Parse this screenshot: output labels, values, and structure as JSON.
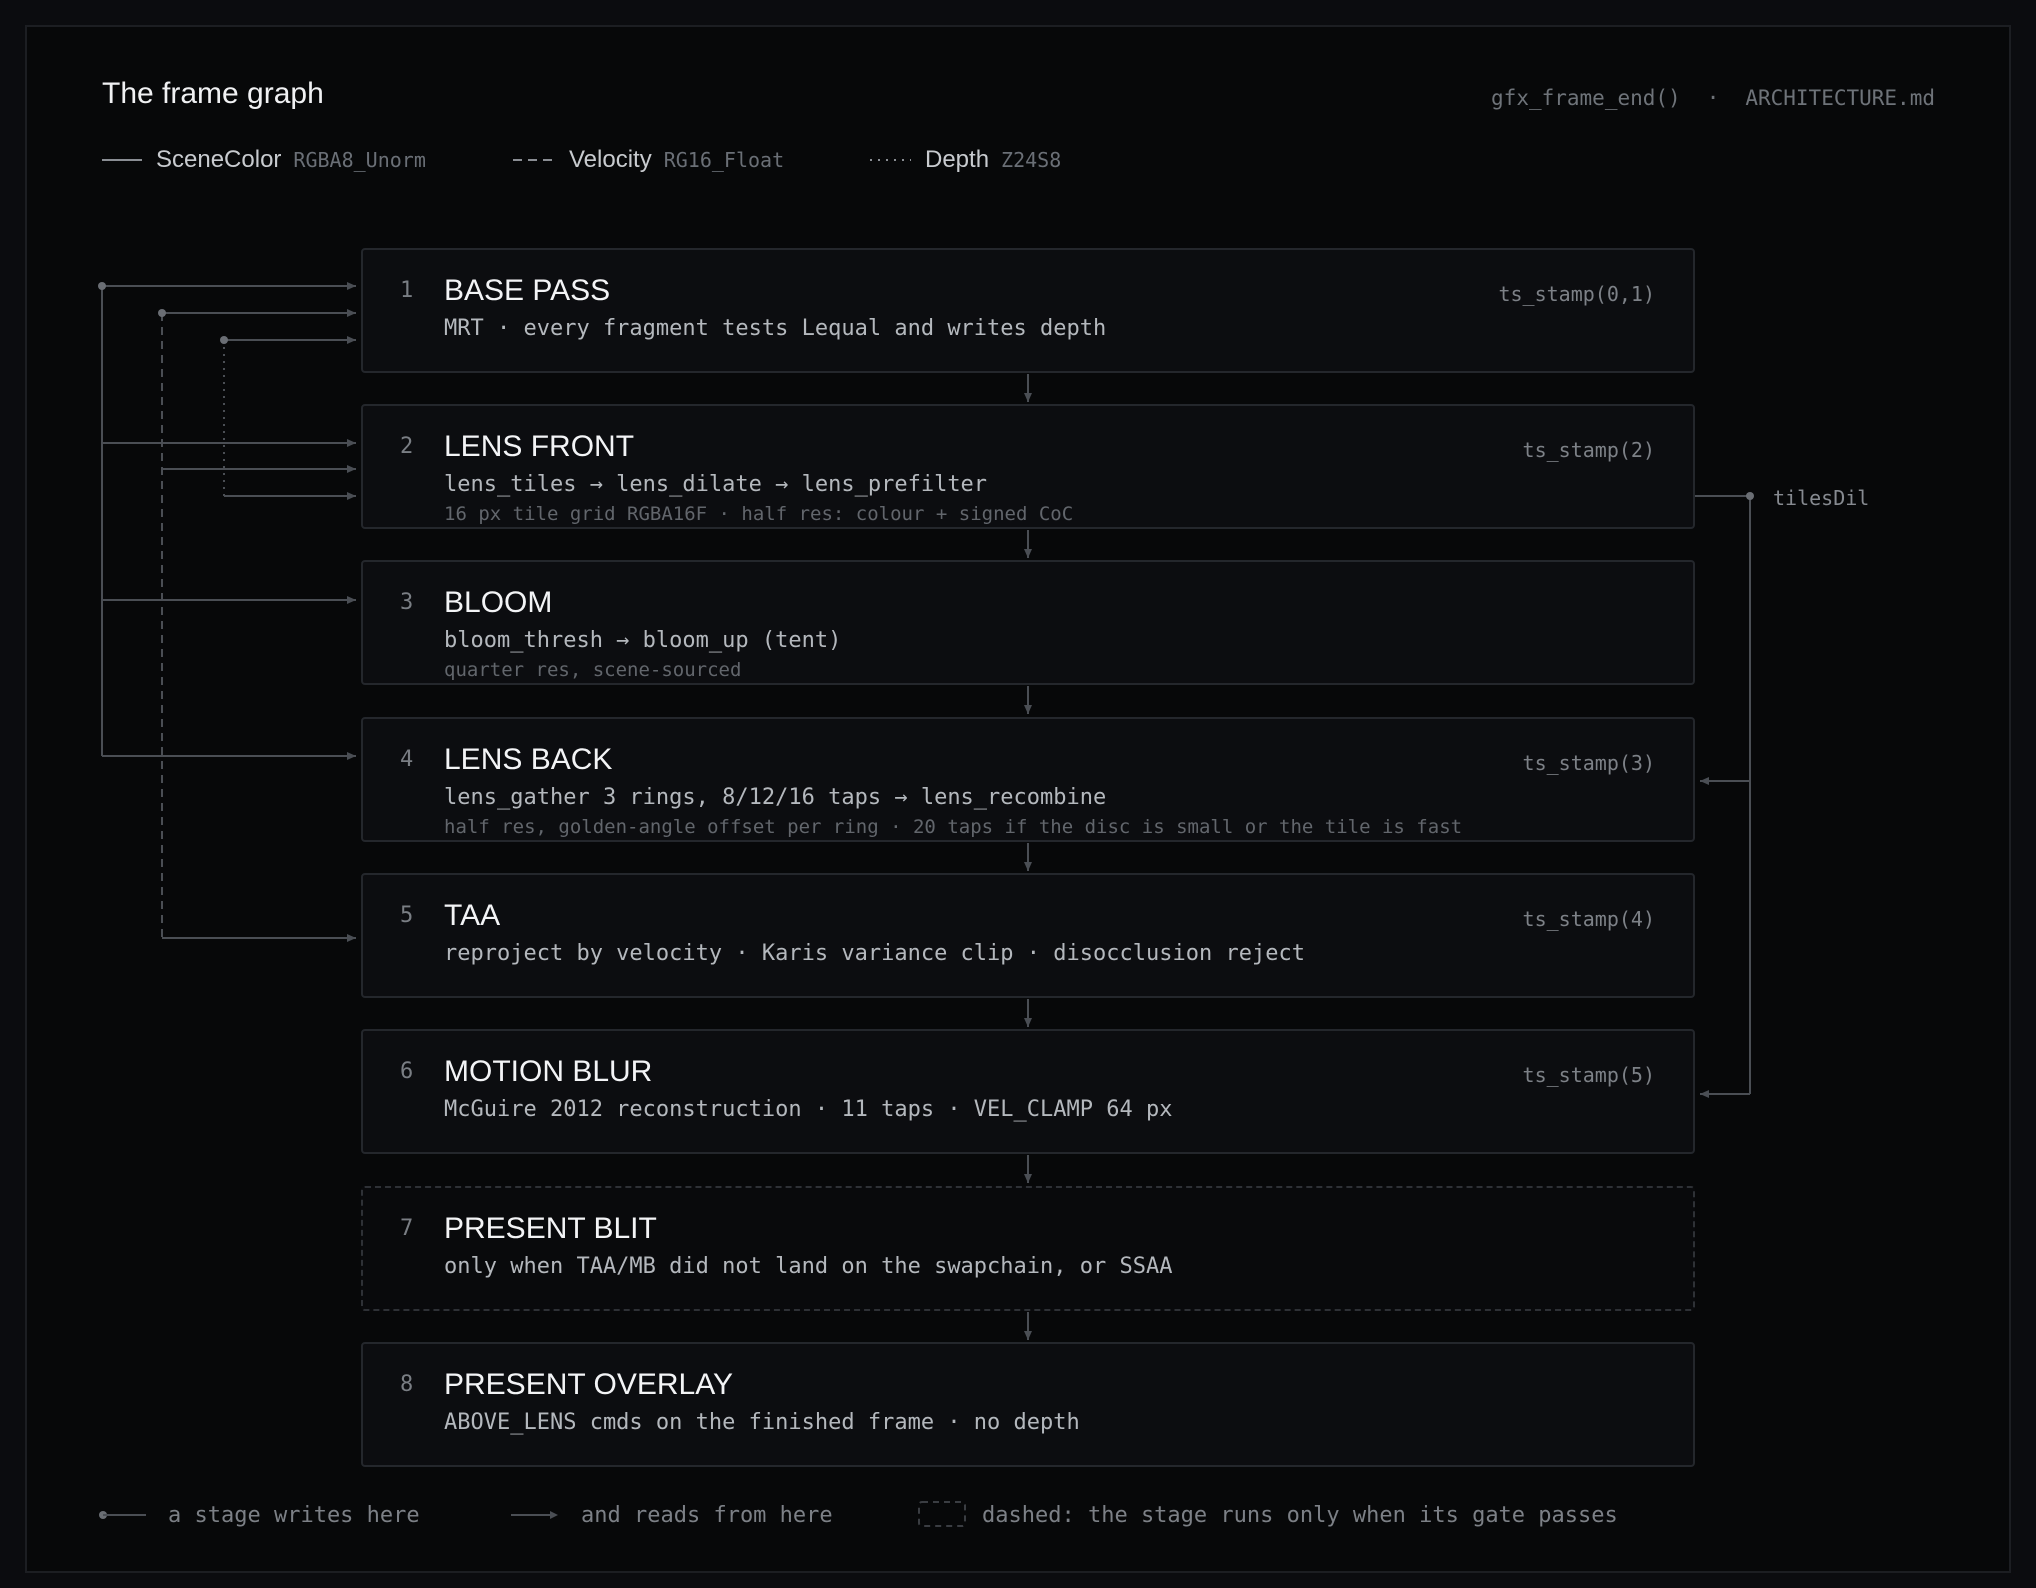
{
  "header": {
    "title": "The frame graph",
    "link_fn": "gfx_frame_end()",
    "separator": "·",
    "link_doc": "ARCHITECTURE.md"
  },
  "legend": [
    {
      "name": "SceneColor",
      "format": "RGBA8_Unorm",
      "line_style": "solid"
    },
    {
      "name": "Velocity",
      "format": "RG16_Float",
      "line_style": "dashed"
    },
    {
      "name": "Depth",
      "format": "Z24S8",
      "line_style": "dotted"
    }
  ],
  "stages": [
    {
      "num": "1",
      "name": "BASE PASS",
      "desc": "MRT · every fragment tests Lequal and writes depth",
      "sub": "",
      "ts": "ts_stamp(0,1)",
      "gated": false
    },
    {
      "num": "2",
      "name": "LENS FRONT",
      "desc": "lens_tiles → lens_dilate → lens_prefilter",
      "sub": "16 px tile grid RGBA16F  ·  half res: colour + signed CoC",
      "ts": "ts_stamp(2)",
      "gated": false
    },
    {
      "num": "3",
      "name": "BLOOM",
      "desc": "bloom_thresh → bloom_up (tent)",
      "sub": "quarter res, scene-sourced",
      "ts": "",
      "gated": false
    },
    {
      "num": "4",
      "name": "LENS BACK",
      "desc": "lens_gather 3 rings, 8/12/16 taps → lens_recombine",
      "sub": "half res, golden-angle offset per ring  ·  20 taps if the disc is small or the tile is fast",
      "ts": "ts_stamp(3)",
      "gated": false
    },
    {
      "num": "5",
      "name": "TAA",
      "desc": "reproject by velocity · Karis variance clip · disocclusion reject",
      "sub": "",
      "ts": "ts_stamp(4)",
      "gated": false
    },
    {
      "num": "6",
      "name": "MOTION BLUR",
      "desc": "McGuire 2012 reconstruction · 11 taps · VEL_CLAMP 64 px",
      "sub": "",
      "ts": "ts_stamp(5)",
      "gated": false
    },
    {
      "num": "7",
      "name": "PRESENT BLIT",
      "desc": "only when TAA/MB did not land on the swapchain, or SSAA",
      "sub": "",
      "ts": "",
      "gated": true
    },
    {
      "num": "8",
      "name": "PRESENT OVERLAY",
      "desc": "ABOVE_LENS cmds on the finished frame · no depth",
      "sub": "",
      "ts": "",
      "gated": false
    }
  ],
  "side_resource": {
    "label": "tilesDil"
  },
  "footer": {
    "writes": "a stage writes here",
    "reads": "and reads from here",
    "gated": "dashed: the stage runs only when its gate passes"
  },
  "colors": {
    "background": "#070809",
    "border": "#24272c",
    "wire": "#4a4e54",
    "text_primary": "#f3f4f6",
    "text_mono": "#b4b8bd",
    "text_muted": "#62666c"
  }
}
